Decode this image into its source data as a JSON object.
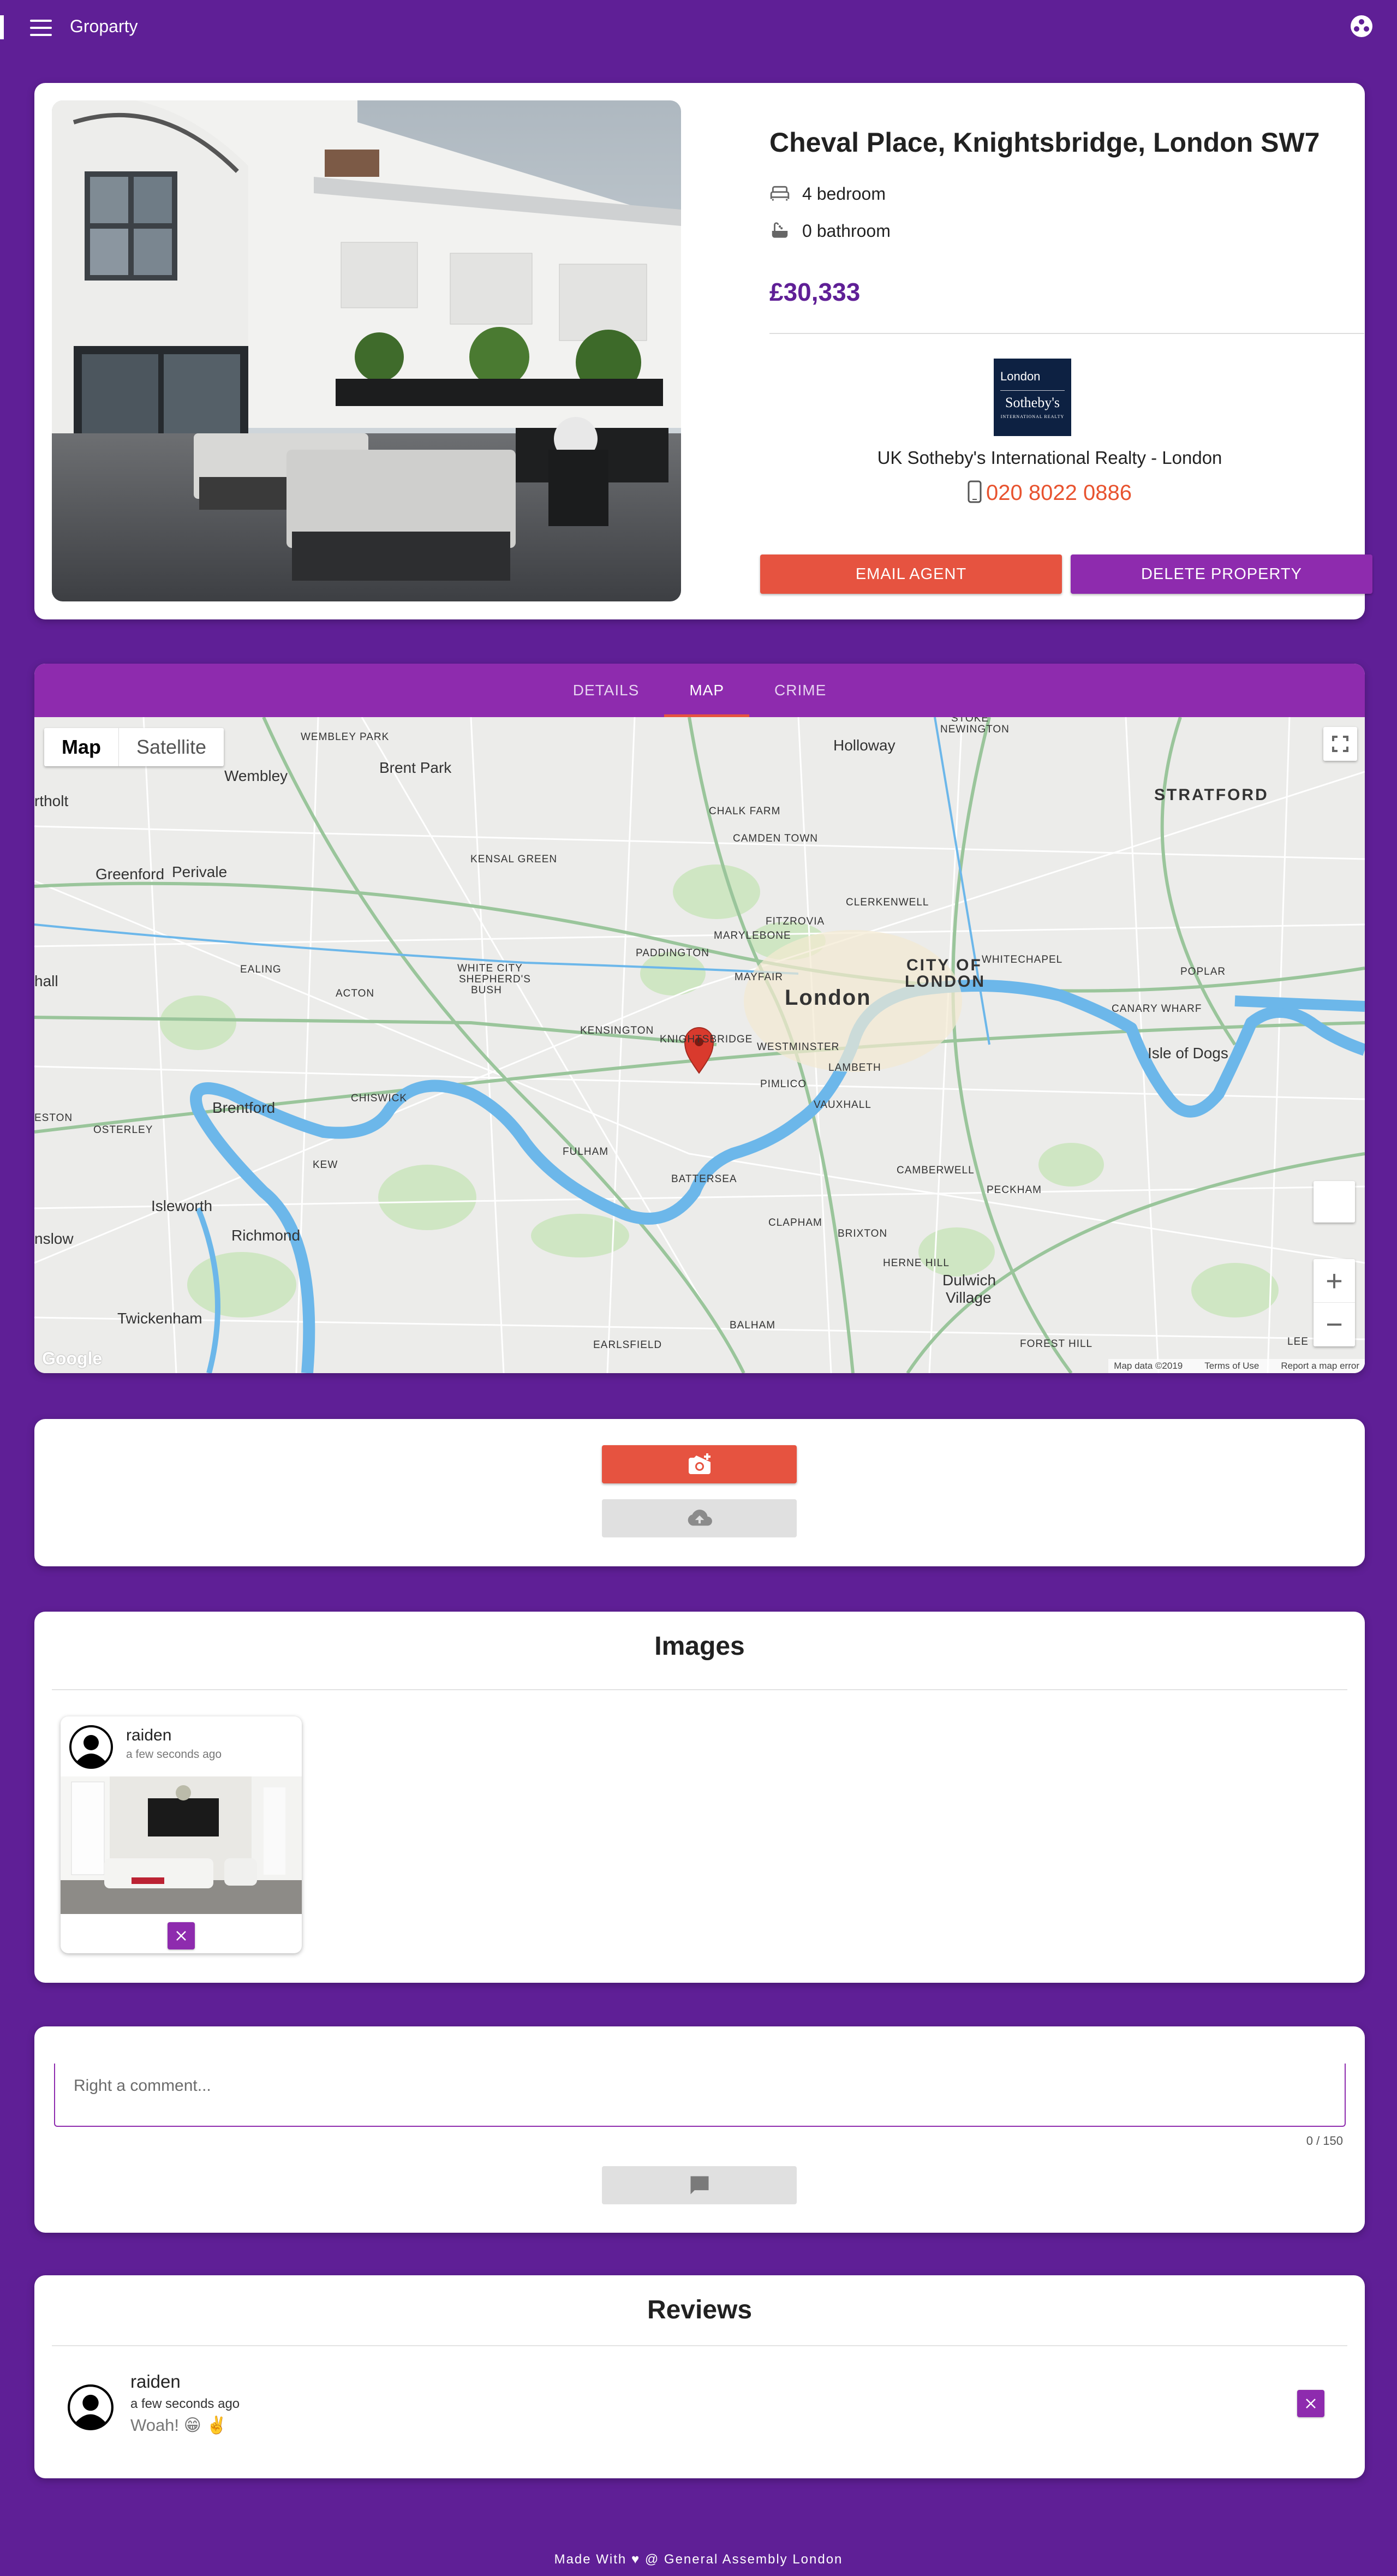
{
  "appbar": {
    "title": "Groparty"
  },
  "property": {
    "address": "Cheval Place, Knightsbridge, London SW7",
    "bedrooms": "4 bedroom",
    "bathrooms": "0 bathroom",
    "price": "£30,333",
    "agent": {
      "logo_line1": "London",
      "logo_line2": "Sotheby's",
      "logo_line3": "INTERNATIONAL REALTY",
      "name": "UK Sotheby's International Realty - London",
      "phone": "020 8022 0886"
    },
    "email_label": "EMAIL AGENT",
    "delete_label": "DELETE PROPERTY"
  },
  "tabs": [
    {
      "label": "DETAILS"
    },
    {
      "label": "MAP"
    },
    {
      "label": "CRIME"
    }
  ],
  "active_tab": "MAP",
  "map": {
    "type_options": [
      "Map",
      "Satellite"
    ],
    "selected_type": "Map",
    "zoom_in": "+",
    "zoom_out": "−",
    "attribution": "Google",
    "footer": [
      "Map data ©2019",
      "Terms of Use",
      "Report a map error"
    ],
    "labels": {
      "london": "London",
      "city": "CITY OF",
      "city2": "LONDON",
      "stratford": "STRATFORD",
      "wembley": "Wembley",
      "wembley_park": "WEMBLEY PARK",
      "brent_park": "Brent Park",
      "holloway": "Holloway",
      "stoke_newington": "STOKE",
      "stoke_newington2": "NEWINGTON",
      "northolt": "rtholt",
      "chalk_farm": "CHALK FARM",
      "camden": "CAMDEN TOWN",
      "kensal": "KENSAL GREEN",
      "greenford": "Greenford",
      "perivale": "Perivale",
      "clerkenwell": "CLERKENWELL",
      "fitzrovia": "FITZROVIA",
      "marylebone": "MARYLEBONE",
      "whitechapel": "WHITECHAPEL",
      "paddington": "PADDINGTON",
      "white_city": "WHITE CITY",
      "shepherds": "SHEPHERD'S",
      "bush": "BUSH",
      "ealing": "EALING",
      "acton": "ACTON",
      "mayfair": "MAYFAIR",
      "poplar": "POPLAR",
      "hall": "hall",
      "kensington": "KENSINGTON",
      "knightsbridge": "KNIGHTSBRIDGE",
      "westminster": "WESTMINSTER",
      "canary": "CANARY WHARF",
      "isle_dogs": "Isle of Dogs",
      "lambeth": "LAMBETH",
      "pimlico": "PIMLICO",
      "chiswick": "CHISWICK",
      "brentford": "Brentford",
      "vauxhall": "VAUXHALL",
      "eston": "ESTON",
      "osterley": "OSTERLEY",
      "fulham": "FULHAM",
      "kew": "KEW",
      "battersea": "BATTERSEA",
      "camberwell": "CAMBERWELL",
      "peckham": "PECKHAM",
      "isleworth": "Isleworth",
      "clapham": "CLAPHAM",
      "richmond": "Richmond",
      "brixton": "BRIXTON",
      "hounslow": "nslow",
      "herne_hill": "HERNE HILL",
      "dulwich": "Dulwich",
      "dulwich2": "Village",
      "lee": "LEE",
      "twickenham": "Twickenham",
      "balham": "BALHAM",
      "forest_hill": "FOREST HILL",
      "earlsfield": "EARLSFIELD"
    }
  },
  "images_section": {
    "heading": "Images",
    "posts": [
      {
        "user": "raiden",
        "time": "a few seconds ago"
      }
    ]
  },
  "comment": {
    "placeholder": "Right a comment...",
    "value": "",
    "counter": "0 / 150"
  },
  "reviews": {
    "heading": "Reviews",
    "items": [
      {
        "user": "raiden",
        "time": "a few seconds ago",
        "text": "Woah! 😁 ✌️"
      }
    ]
  },
  "footer": {
    "text": "Made With ♥ @ General Assembly London"
  },
  "colors": {
    "background": "#5f1f96",
    "accent_purple": "#8e2bae",
    "accent_red": "#e65340",
    "price": "#5f1f96",
    "phone": "#e8532f"
  },
  "icons": [
    "menu-icon",
    "avatar-icon",
    "bed-icon",
    "bath-icon",
    "phone-icon",
    "map-pin-icon",
    "fullscreen-icon",
    "add-photo-icon",
    "cloud-upload-icon",
    "comment-icon",
    "close-icon",
    "user-avatar-icon"
  ]
}
